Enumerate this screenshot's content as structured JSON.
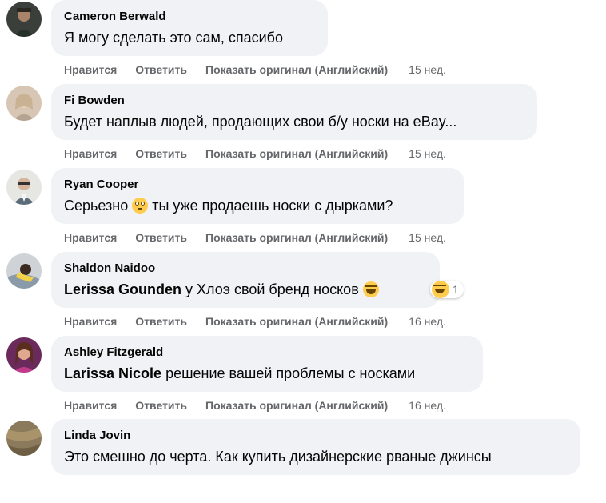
{
  "comments": [
    {
      "author": "Cameron Berwald",
      "mention": "",
      "text": "Я могу сделать это сам, спасибо",
      "emoji": "",
      "reaction": null,
      "actions": {
        "like": "Нравится",
        "reply": "Ответить",
        "translate": "Показать оригинал (Английский)",
        "time": "15 нед."
      }
    },
    {
      "author": "Fi Bowden",
      "mention": "",
      "text": "Будет наплыв людей, продающих свои б/у носки на eBay...",
      "emoji": "",
      "reaction": null,
      "actions": {
        "like": "Нравится",
        "reply": "Ответить",
        "translate": "Показать оригинал (Английский)",
        "time": "15 нед."
      }
    },
    {
      "author": "Ryan Cooper",
      "mention": "",
      "text_before": "Серьезно ",
      "emoji": "flushed-face-emoji",
      "text": " ты уже продаешь носки с дырками?",
      "reaction": null,
      "actions": {
        "like": "Нравится",
        "reply": "Ответить",
        "translate": "Показать оригинал (Английский)",
        "time": "15 нед."
      }
    },
    {
      "author": "Shaldon Naidoo",
      "mention": "Lerissa Gounden",
      "text": " у Хлоэ свой бренд носков ",
      "emoji": "laughing-tears-emoji",
      "reaction": {
        "icon": "haha-reaction-icon",
        "count": "1"
      },
      "actions": {
        "like": "Нравится",
        "reply": "Ответить",
        "translate": "Показать оригинал (Английский)",
        "time": "16 нед."
      }
    },
    {
      "author": "Ashley Fitzgerald",
      "mention": "Larissa Nicole",
      "text": " решение вашей проблемы с носками",
      "emoji": "",
      "reaction": null,
      "actions": {
        "like": "Нравится",
        "reply": "Ответить",
        "translate": "Показать оригинал (Английский)",
        "time": "16 нед."
      }
    },
    {
      "author": "Linda Jovin",
      "mention": "",
      "text": "Это смешно до черта. Как купить дизайнерские рваные джинсы",
      "emoji": "",
      "reaction": null,
      "actions": null
    }
  ],
  "colors": {
    "bubble": "#f0f2f5",
    "text": "#050505",
    "secondary_text": "#65676b"
  }
}
